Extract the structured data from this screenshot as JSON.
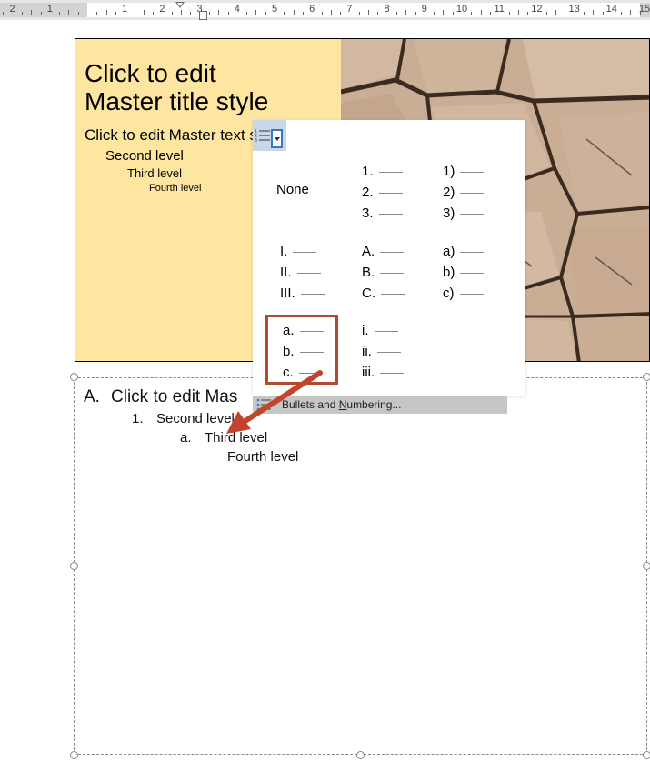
{
  "ruler": {
    "numbers": [
      "2",
      "1",
      "1",
      "2",
      "3",
      "4",
      "5",
      "6",
      "7",
      "8",
      "9",
      "10",
      "11",
      "12",
      "13",
      "14",
      "15"
    ]
  },
  "slide_master": {
    "title": "Click to edit\nMaster title style",
    "level1": "Click to edit Master text styles",
    "level2": "Second level",
    "level3": "Third level",
    "level4": "Fourth level"
  },
  "numbering_gallery": {
    "none_label": "None",
    "styles": [
      {
        "id": "arabic-period",
        "items": [
          "1.",
          "2.",
          "3."
        ]
      },
      {
        "id": "arabic-paren",
        "items": [
          "1)",
          "2)",
          "3)"
        ]
      },
      {
        "id": "roman-upper",
        "items": [
          "I.",
          "II.",
          "III."
        ]
      },
      {
        "id": "alpha-upper",
        "items": [
          "A.",
          "B.",
          "C."
        ]
      },
      {
        "id": "alpha-lower-paren",
        "items": [
          "a)",
          "b)",
          "c)"
        ]
      },
      {
        "id": "alpha-lower-period",
        "items": [
          "a.",
          "b.",
          "c."
        ]
      },
      {
        "id": "roman-lower",
        "items": [
          "i.",
          "ii.",
          "iii."
        ]
      }
    ],
    "menu_item_label": "Bullets and Numbering...",
    "menu_item_accelerator": "N"
  },
  "text_placeholder": {
    "line1_num": "A.",
    "line1_text": "Click to edit Mas",
    "line2_num": "1.",
    "line2_text": "Second level",
    "line3_num": "a.",
    "line3_text": "Third level",
    "line4_text": "Fourth level"
  },
  "colors": {
    "highlight": "#b14a33",
    "slide_panel": "#fee6a0",
    "button_accent": "#3b78c4"
  }
}
